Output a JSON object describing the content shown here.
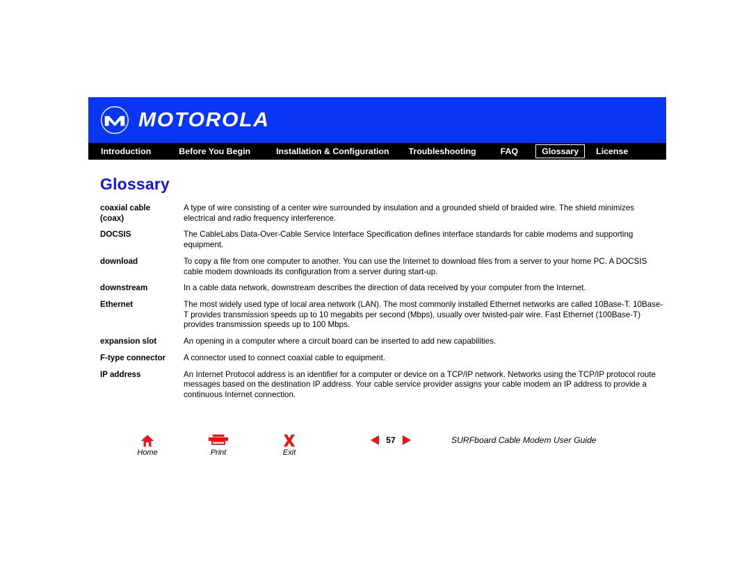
{
  "header": {
    "brand_name": "MOTOROLA",
    "logo_icon": "motorola-batwing-icon",
    "brand_blue": "#0935F5",
    "nav_background": "#000000"
  },
  "nav": {
    "active_tab": "Glossary",
    "tabs": [
      {
        "label": "Introduction",
        "key": "introduction",
        "active": false
      },
      {
        "label": "Before You Begin",
        "key": "before",
        "active": false
      },
      {
        "label": "Installation & Configuration",
        "key": "installation",
        "active": false
      },
      {
        "label": "Troubleshooting",
        "key": "troubleshooting",
        "active": false
      },
      {
        "label": "FAQ",
        "key": "faq",
        "active": false
      },
      {
        "label": "Glossary",
        "key": "glossary",
        "active": true
      },
      {
        "label": "License",
        "key": "license",
        "active": false
      }
    ]
  },
  "main": {
    "title": "Glossary",
    "title_color": "#1414E6",
    "entries": [
      {
        "term": "coaxial cable (coax)",
        "definition": "A type of wire consisting of a center wire surrounded by insulation and a grounded shield of braided wire. The shield minimizes electrical and radio frequency interference."
      },
      {
        "term": "DOCSIS",
        "definition": "The CableLabs Data-Over-Cable Service Interface Specification defines interface standards for cable modems and supporting equipment."
      },
      {
        "term": "download",
        "definition": "To copy a file from one computer to another. You can use the Internet to download files from a server to your home PC. A DOCSIS cable modem downloads its configuration from a server during start-up."
      },
      {
        "term": "downstream",
        "definition": "In a cable data network, downstream describes the direction of data received by your computer from the Internet."
      },
      {
        "term": "Ethernet",
        "definition": "The most widely used type of local area network (LAN). The most commonly installed Ethernet networks are called 10Base-T. 10Base-T provides transmission speeds up to 10 megabits per second (Mbps), usually over twisted-pair wire. Fast Ethernet (100Base-T) provides transmission speeds up to 100 Mbps."
      },
      {
        "term": "expansion slot",
        "definition": "An opening in a computer where a circuit board can be inserted to add new capabilities."
      },
      {
        "term": "F-type connector",
        "definition": "A connector used to connect coaxial cable to equipment."
      },
      {
        "term": "IP address",
        "definition": "An Internet Protocol address is an identifier for a computer or device on a TCP/IP network. Networks using the TCP/IP protocol route messages based on the destination IP address. Your cable service provider assigns your cable modem an IP address to provide a continuous Internet connection."
      }
    ]
  },
  "footer": {
    "buttons": [
      {
        "label": "Home",
        "icon": "home-icon"
      },
      {
        "label": "Print",
        "icon": "printer-icon"
      },
      {
        "label": "Exit",
        "icon": "close-x-icon"
      }
    ],
    "pager": {
      "prev_icon": "triangle-left-icon",
      "next_icon": "triangle-right-icon",
      "page_number": "57"
    },
    "guide_title": "SURFboard Cable Modem User Guide",
    "accent_red": "#EE1111"
  }
}
